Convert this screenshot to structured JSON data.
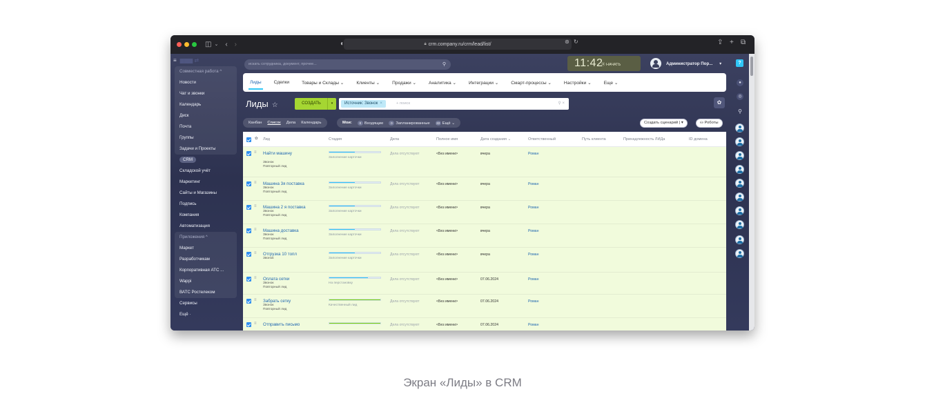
{
  "browser": {
    "url": "crm.company.ru/crm/lead/list/",
    "traffic_lights": [
      "#ff5f57",
      "#febc2e",
      "#28c840"
    ]
  },
  "header": {
    "search_placeholder": "искать сотрудника, документ, прочее...",
    "clock_time": "11:42",
    "clock_action": "⦿ НАЧАТЬ",
    "user_name": "Администратор Пор...",
    "user_chevron": "▾"
  },
  "sidebar": {
    "items": [
      {
        "label": "Совместная работа ^",
        "kind": "header"
      },
      {
        "label": "Новости"
      },
      {
        "label": "Чат и звонки"
      },
      {
        "label": "Календарь"
      },
      {
        "label": "Диск"
      },
      {
        "label": "Почта"
      },
      {
        "label": "Группы"
      },
      {
        "label": "Задачи и Проекты"
      },
      {
        "label": "CRM",
        "kind": "active"
      },
      {
        "label": "Складской учёт"
      },
      {
        "label": "Маркетинг"
      },
      {
        "label": "Сайты и Магазины"
      },
      {
        "label": "Подпись"
      },
      {
        "label": "Компания"
      },
      {
        "label": "Автоматизация"
      },
      {
        "label": "Приложения ^",
        "kind": "header"
      },
      {
        "label": "Маркет"
      },
      {
        "label": "Разработчикам"
      },
      {
        "label": "Корпоративная АТС ..."
      },
      {
        "label": "Wappi"
      },
      {
        "label": "ВАТС Ростелеком"
      },
      {
        "label": "Сервисы"
      },
      {
        "label": "Ещё ·"
      }
    ]
  },
  "top_menu": [
    {
      "label": "Лиды",
      "active": true
    },
    {
      "label": "Сделки"
    },
    {
      "label": "Товары и Склады ⌄"
    },
    {
      "label": "Клиенты ⌄"
    },
    {
      "label": "Продажи ⌄"
    },
    {
      "label": "Аналитика ⌄"
    },
    {
      "label": "Интеграции ⌄"
    },
    {
      "label": "Смарт-процессы ⌄"
    },
    {
      "label": "Настройки ⌄"
    },
    {
      "label": "Еще ⌄"
    }
  ],
  "page": {
    "title": "Лиды",
    "star": "☆",
    "create_button": "СОЗДАТЬ",
    "create_arrow": "▾",
    "filter_chip": "Источник: Звонок",
    "filter_chip_close": "×",
    "filter_placeholder": "+ поиск",
    "filter_icons": "⚲ ×",
    "settings_icon": "✿"
  },
  "view_tabs": [
    "Канбан",
    "Список",
    "Дела",
    "Календарь"
  ],
  "view_active": "Список",
  "counters": {
    "label": "Мои:",
    "items": [
      {
        "badge": "0",
        "label": "Входящие"
      },
      {
        "badge": "0",
        "label": "Запланированные"
      },
      {
        "badge": "22",
        "label": "Ещё ⌄"
      }
    ]
  },
  "actions": {
    "scenario_button": "Создать сценарий  |  ▾",
    "robots_button": "⛀ Роботы"
  },
  "table": {
    "columns": [
      "Лид",
      "Стадия",
      "Дела",
      "Полное имя",
      "Дата создания ⌄",
      "Ответственный",
      "Путь клиента",
      "Принадлежность ЛИДа",
      "ID домена"
    ],
    "rows": [
      {
        "title": "Найти машину",
        "sub1": "Звонок",
        "sub2": "Повторный лид",
        "stage": "Заполнение карточки",
        "progress": 0.5,
        "color": "#2fc6f6",
        "deals": "Дела отсутствуют",
        "name": "<Без имени>",
        "date": "вчера",
        "resp": "Роман"
      },
      {
        "title": "Машина 3я поставка",
        "sub1": "Звонок",
        "sub2": "Повторный лид",
        "stage": "Заполнение карточки",
        "progress": 0.5,
        "color": "#2fc6f6",
        "deals": "Дела отсутствуют",
        "name": "<Без имени>",
        "date": "вчера",
        "resp": "Роман"
      },
      {
        "title": "Машина 2 я поставка",
        "sub1": "Звонок",
        "sub2": "Повторный лид",
        "stage": "Заполнение карточки",
        "progress": 0.5,
        "color": "#2fc6f6",
        "deals": "Дела отсутствуют",
        "name": "<Без имени>",
        "date": "вчера",
        "resp": "Роман"
      },
      {
        "title": "Машина        доставка",
        "sub1": "Звонок",
        "sub2": "Повторный лид",
        "stage": "Заполнение карточки",
        "progress": 0.5,
        "color": "#2fc6f6",
        "deals": "Дела отсутствуют",
        "name": "<Без имени>",
        "date": "вчера",
        "resp": "Роман"
      },
      {
        "title": "Отгрузка 10 топл",
        "sub1": "Звонок",
        "sub2": "",
        "stage": "Заполнение карточки",
        "progress": 0.5,
        "color": "#2fc6f6",
        "deals": "Дела отсутствуют",
        "name": "<Без имени>",
        "date": "вчера",
        "resp": "Роман"
      },
      {
        "title": "Оплата сетки",
        "sub1": "Звонок",
        "sub2": "Повторный лид",
        "stage": "На перстановку",
        "progress": 0.75,
        "color": "#2fc6f6",
        "deals": "Дела отсутствуют",
        "name": "<Без имени>",
        "date": "07.06.2024",
        "resp": "Роман"
      },
      {
        "title": "Забрать сетку",
        "sub1": "Звонок",
        "sub2": "Повторный лид",
        "stage": "Качественный лид",
        "progress": 1.0,
        "color": "#7bd500",
        "deals": "Дела отсутствуют",
        "name": "<Без имени>",
        "date": "07.06.2024",
        "resp": "Роман"
      },
      {
        "title": "Отправить письмо",
        "sub1": "",
        "sub2": "",
        "stage": "",
        "progress": 1.0,
        "color": "#7bd500",
        "deals": "Дела отсутствуют",
        "name": "<Без имени>",
        "date": "07.06.2024",
        "resp": "Роман"
      }
    ]
  },
  "caption": "Экран «Лиды» в CRM"
}
